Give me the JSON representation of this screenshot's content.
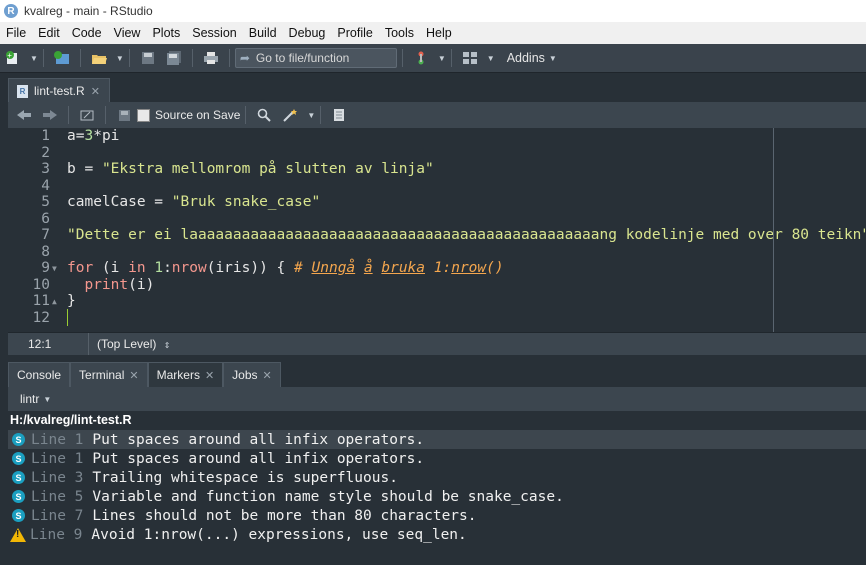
{
  "window": {
    "title": "kvalreg - main - RStudio"
  },
  "menu": [
    "File",
    "Edit",
    "Code",
    "View",
    "Plots",
    "Session",
    "Build",
    "Debug",
    "Profile",
    "Tools",
    "Help"
  ],
  "toolbar": {
    "goto_label": "Go to file/function",
    "addins_label": "Addins"
  },
  "editor": {
    "tab_label": "lint-test.R",
    "source_on_save_label": "Source on Save",
    "cursor_position": "12:1",
    "scope": "(Top Level)",
    "line_numbers": [
      "1",
      "2",
      "3",
      "4",
      "5",
      "6",
      "7",
      "8",
      "9",
      "10",
      "11",
      "12"
    ],
    "code": {
      "l1_a": "a",
      "l1_op": "=",
      "l1_num": "3",
      "l1_op2": "*",
      "l1_pi": "pi",
      "l3_var": "b",
      "l3_op": " = ",
      "l3_str": "\"Ekstra mellomrom på slutten av linja\"",
      "l5_var": "camelCase",
      "l5_op": " = ",
      "l5_str": "\"Bruk snake_case\"",
      "l7_str": "\"Dette er ei laaaaaaaaaaaaaaaaaaaaaaaaaaaaaaaaaaaaaaaaaaaaaaang kodelinje med over 80 teikn\"",
      "l9_for": "for",
      "l9_open": " (",
      "l9_i": "i",
      "l9_in": " in ",
      "l9_num": "1",
      "l9_colon": ":",
      "l9_nrow": "nrow",
      "l9_args": "(iris)) { ",
      "l9_cmt_hash": "# ",
      "l9_cmt_w1": "Unngå",
      "l9_cmt_sp1": " ",
      "l9_cmt_w2": "å",
      "l9_cmt_sp2": " ",
      "l9_cmt_w3": "bruka",
      "l9_cmt_sp3": " 1:",
      "l9_cmt_w4": "nrow",
      "l9_cmt_end": "()",
      "l10_indent": "  ",
      "l10_fn": "print",
      "l10_args": "(i)",
      "l11": "}"
    }
  },
  "bottom_panel": {
    "tabs": [
      {
        "label": "Console",
        "closable": false,
        "active": false
      },
      {
        "label": "Terminal",
        "closable": true,
        "active": false
      },
      {
        "label": "Markers",
        "closable": true,
        "active": true
      },
      {
        "label": "Jobs",
        "closable": true,
        "active": false
      }
    ],
    "filter_label": "lintr",
    "file_path": "H:/kvalreg/lint-test.R",
    "markers": [
      {
        "type": "style",
        "icon": "S",
        "line": "Line 1",
        "message": "Put spaces around all infix operators.",
        "selected": true
      },
      {
        "type": "style",
        "icon": "S",
        "line": "Line 1",
        "message": "Put spaces around all infix operators.",
        "selected": false
      },
      {
        "type": "style",
        "icon": "S",
        "line": "Line 3",
        "message": "Trailing whitespace is superfluous.",
        "selected": false
      },
      {
        "type": "style",
        "icon": "S",
        "line": "Line 5",
        "message": "Variable and function name style should be snake_case.",
        "selected": false
      },
      {
        "type": "style",
        "icon": "S",
        "line": "Line 7",
        "message": "Lines should not be more than 80 characters.",
        "selected": false
      },
      {
        "type": "warning",
        "icon": "warning-icon",
        "line": "Line 9",
        "message": "Avoid 1:nrow(...) expressions, use seq_len.",
        "selected": false
      }
    ]
  },
  "colors": {
    "background": "#283037",
    "string": "#d9e58f",
    "keyword": "#f4978e",
    "comment": "#f4a64e",
    "style_marker": "#1b9fc0",
    "warning_marker": "#f2b705"
  }
}
